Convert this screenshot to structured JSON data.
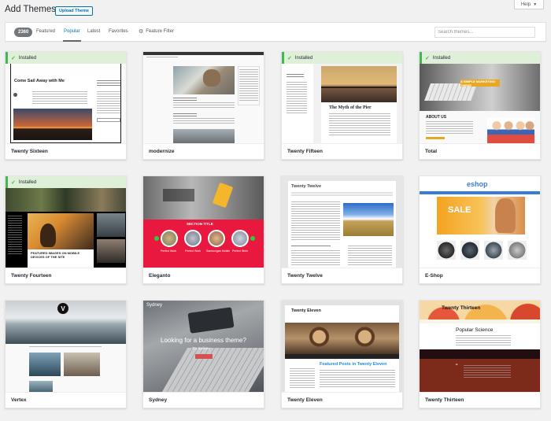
{
  "header": {
    "title": "Add Themes",
    "upload_label": "Upload Theme",
    "help_label": "Help"
  },
  "filters": {
    "count": "2360",
    "tabs": [
      "Featured",
      "Popular",
      "Latest",
      "Favorites"
    ],
    "active_tab": "Popular",
    "feature_filter_label": "Feature Filter",
    "search_placeholder": "Search themes..."
  },
  "installed_label": "Installed",
  "themes": [
    {
      "name": "Twenty Sixteen",
      "installed": true
    },
    {
      "name": "modernize",
      "installed": false
    },
    {
      "name": "Twenty Fifteen",
      "installed": true
    },
    {
      "name": "Total",
      "installed": true
    },
    {
      "name": "Twenty Fourteen",
      "installed": true
    },
    {
      "name": "Eleganto",
      "installed": false
    },
    {
      "name": "Twenty Twelve",
      "installed": false
    },
    {
      "name": "E-Shop",
      "installed": false
    },
    {
      "name": "Vertex",
      "installed": false
    },
    {
      "name": "Sydney",
      "installed": false
    },
    {
      "name": "Twenty Eleven",
      "installed": false
    },
    {
      "name": "Twenty Thirteen",
      "installed": false
    }
  ],
  "previews": {
    "sixteen_post_title": "Come Sail Away with Me",
    "fifteen_post_title": "The Myth of the Pier",
    "total_banner": "A SIMPLE MARKETING THEME",
    "total_about": "ABOUT US",
    "fourteen_post_title": "FEATURED IMAGES ON MOBILE DEVICES OF THE SITE",
    "eleganto_section": "SECTION TITLE",
    "eleganto_items": [
      "Perfect Work",
      "Perfect Work",
      "Sambungan Mobile",
      "Perfect Work"
    ],
    "twelve_site_title": "Twenty Twelve",
    "eshop_logo": "eshop",
    "eshop_sale": "SALE",
    "vertex_logo": "V",
    "sydney_brand": "Sydney",
    "sydney_headline": "Looking for a business theme?",
    "sydney_sub": "Try Sydney",
    "eleven_site_title": "Twenty Eleven",
    "eleven_post_title": "Featured Posts in Twenty Eleven",
    "thirteen_site_title": "Twenty Thirteen",
    "thirteen_post_title": "Popular Science"
  },
  "colors": {
    "accent": "#0073aa",
    "installed_bg": "#dff0d8",
    "installed_border": "#46b450",
    "eleganto_red": "#e8183e"
  }
}
